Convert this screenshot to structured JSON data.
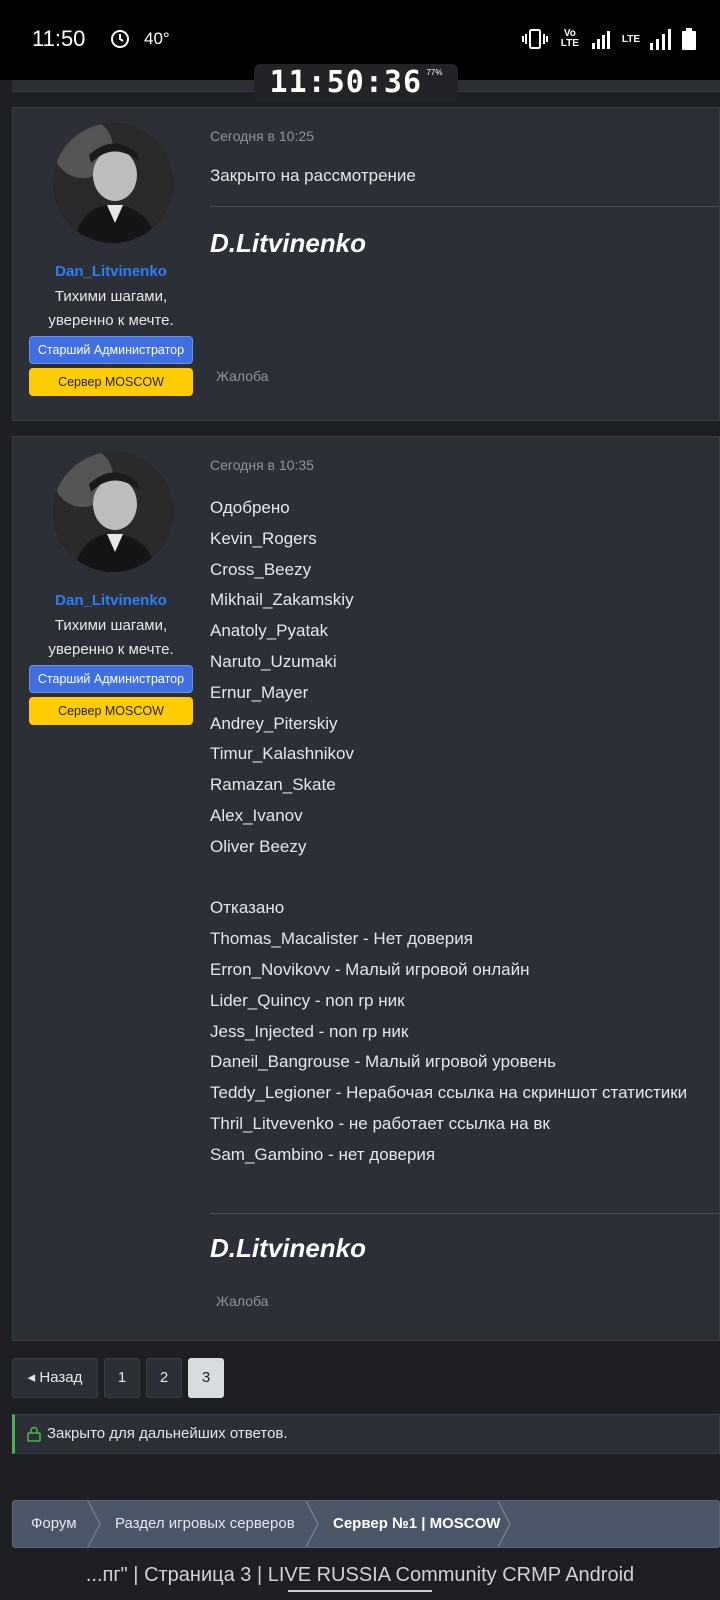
{
  "status_bar": {
    "time": "11:50",
    "temperature": "40°",
    "network": "LTE",
    "volte": "Vo LTE"
  },
  "overlay_clock": {
    "time": "11:50:36",
    "battery": "77%"
  },
  "posts": [
    {
      "author": "Dan_Litvinenko",
      "user_title": "Тихими шагами, уверенно к мечте.",
      "rank_badge": "Старший Администратор",
      "server_badge": "Сервер MOSCOW",
      "date": "Сегодня в 10:25",
      "content": "Закрыто на рассмотрение",
      "signature": "D.Litvinenko",
      "report_link": "Жалоба"
    },
    {
      "author": "Dan_Litvinenko",
      "user_title": "Тихими шагами, уверенно к мечте.",
      "rank_badge": "Старший Администратор",
      "server_badge": "Сервер MOSCOW",
      "date": "Сегодня в 10:35",
      "lines": [
        "Одобрено",
        "Kevin_Rogers",
        "Cross_Beezy",
        "Mikhail_Zakamskiy",
        "Anatoly_Pyatak",
        "Naruto_Uzumaki",
        "Ernur_Mayer",
        "Andrey_Piterskiy",
        "Timur_Kalashnikov",
        "Ramazan_Skate",
        "Alex_Ivanov",
        "Oliver Beezy",
        "",
        "Отказано",
        "Thomas_Macalister - Нет доверия",
        "Erron_Novikovv - Малый игровой онлайн",
        "Lider_Quincy - non rp ник",
        "Jess_Injected - non rp ник",
        "Daneil_Bangrouse - Малый игровой уровень",
        "Teddy_Legioner - Нерабочая ссылка на скриншот статистики",
        "Thril_Litvevenko - не работает ссылка на вк",
        "Sam_Gambino - нет доверия"
      ],
      "signature": "D.Litvinenko",
      "report_link": "Жалоба"
    }
  ],
  "pagination": {
    "prev_label": "◂ Назад",
    "pages": [
      "1",
      "2",
      "3"
    ],
    "current_page": "3"
  },
  "closed_notice": "Закрыто для дальнейших ответов.",
  "breadcrumb": {
    "items": [
      "Форум",
      "Раздел игровых серверов",
      "Сервер №1 | MOSCOW"
    ]
  },
  "footer_title": "...пг\" | Страница 3 | LIVE RUSSIA Community CRMP Android",
  "colors": {
    "accent_blue": "#2d7ff9",
    "admin_badge": "#3f6fe0",
    "server_badge": "#ffcc00",
    "closed_accent": "#4caf50"
  }
}
